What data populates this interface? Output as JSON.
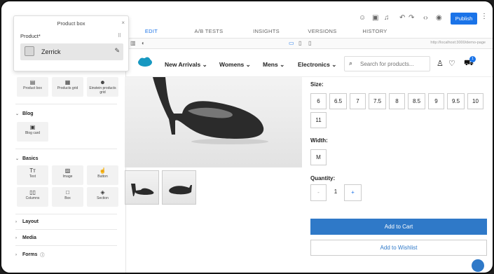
{
  "editor": {
    "tabs": [
      "EDIT",
      "A/B TESTS",
      "INSIGHTS",
      "VERSIONS",
      "HISTORY"
    ],
    "publish_label": "Publish",
    "url": "http://localhost:3000/demo-page"
  },
  "popup": {
    "title": "Product box",
    "field_label": "Product*",
    "selected_product": "Zerrick"
  },
  "sidebar": {
    "top_components": [
      "Product box",
      "Products grid",
      "Einstein products grid"
    ],
    "blog": {
      "title": "Blog",
      "items": [
        "Blog card"
      ]
    },
    "basics": {
      "title": "Basics",
      "items": [
        "Text",
        "Image",
        "Button",
        "Columns",
        "Box",
        "Section"
      ]
    },
    "layout_title": "Layout",
    "media_title": "Media",
    "forms_title": "Forms"
  },
  "store": {
    "nav": [
      "New Arrivals",
      "Womens",
      "Mens",
      "Electronics"
    ],
    "search_placeholder": "Search for products...",
    "cart_count": "1"
  },
  "product": {
    "size_label": "Size:",
    "sizes": [
      "6",
      "6.5",
      "7",
      "7.5",
      "8",
      "8.5",
      "9",
      "9.5",
      "10",
      "11"
    ],
    "width_label": "Width:",
    "widths": [
      "M"
    ],
    "quantity_label": "Quantity:",
    "quantity": "1",
    "minus": "-",
    "plus": "+",
    "add_to_cart": "Add to Cart",
    "add_to_wishlist": "Add to Wishlist"
  },
  "colors": {
    "accent": "#1a73e8",
    "button": "#2f79c8"
  }
}
